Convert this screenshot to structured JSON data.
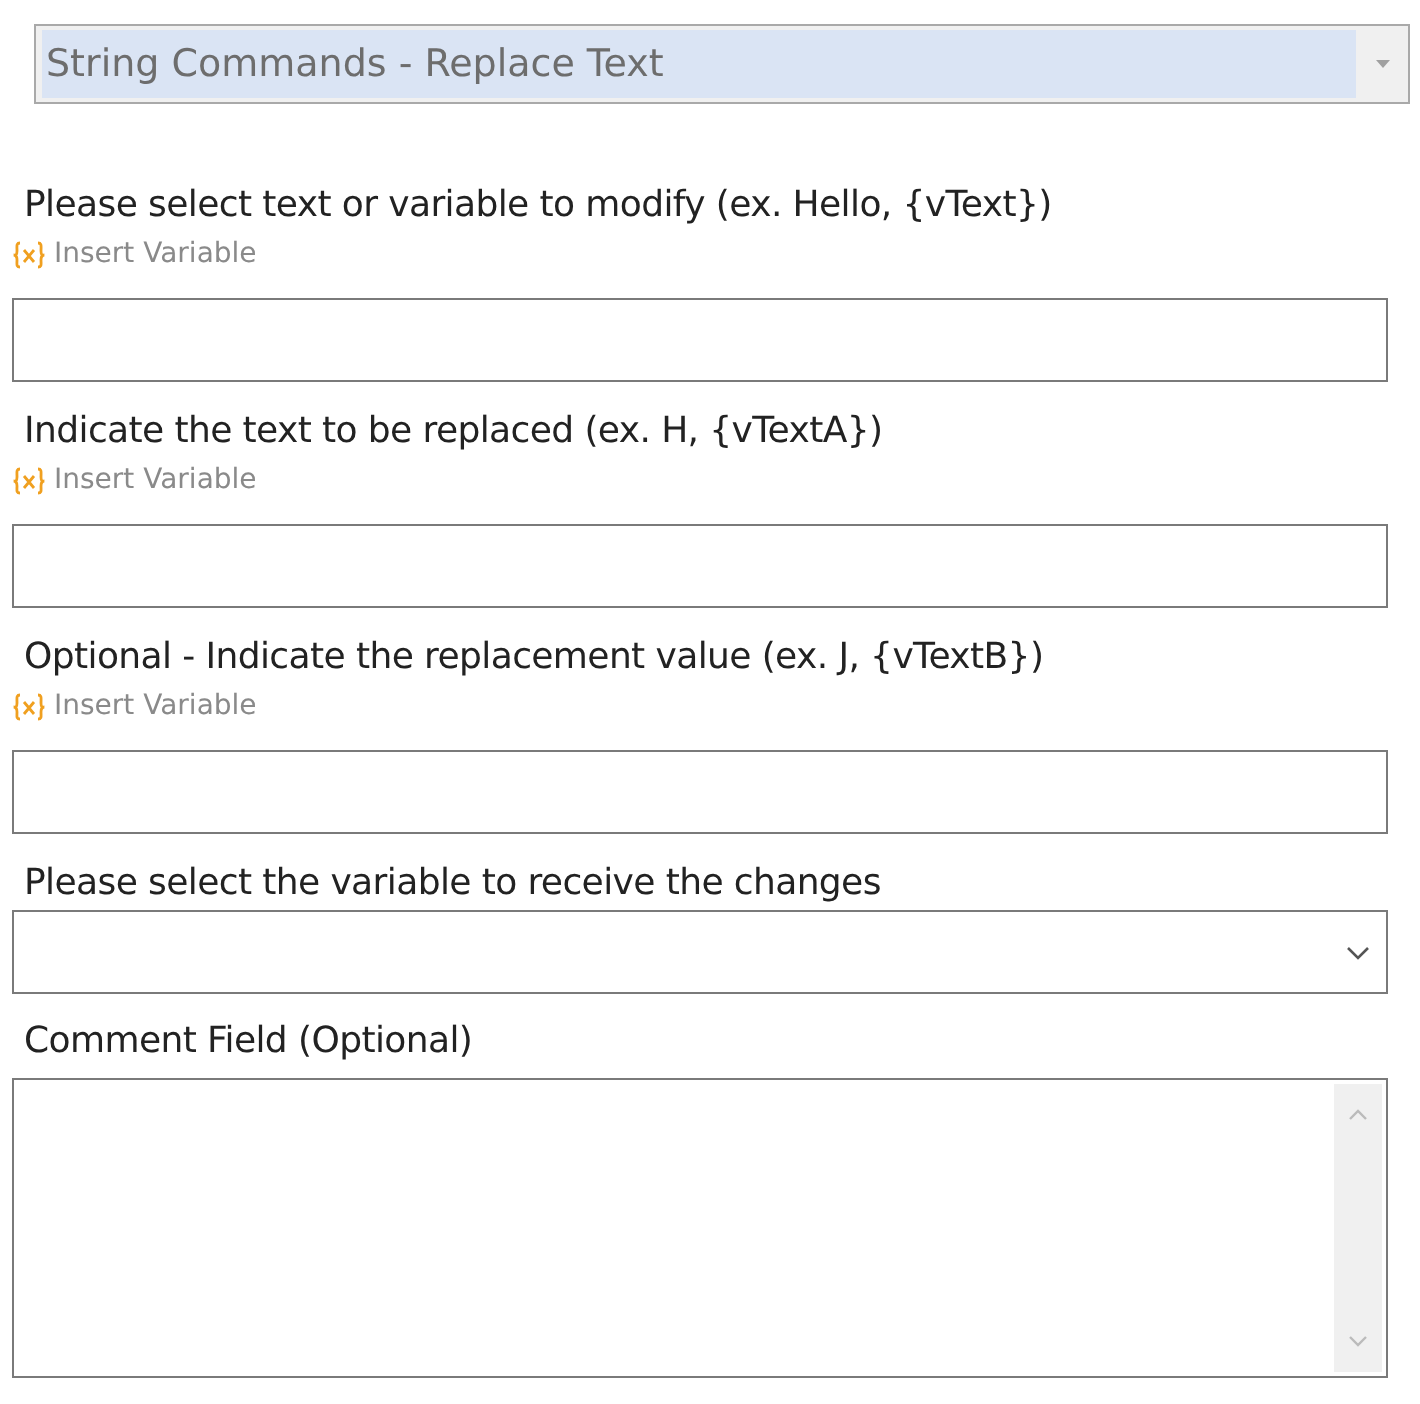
{
  "command_select": {
    "value": "String Commands - Replace Text",
    "selected": true
  },
  "fields": [
    {
      "kind": "text",
      "label": "Please select text or variable to modify (ex. Hello, {vText})",
      "insert_variable": "Insert Variable"
    },
    {
      "kind": "text",
      "label": "Indicate the text to be replaced (ex. H, {vTextA})",
      "insert_variable": "Insert Variable"
    },
    {
      "kind": "text",
      "label": "Optional - Indicate the replacement value (ex. J, {vTextB})",
      "insert_variable": "Insert Variable"
    },
    {
      "kind": "dropdown",
      "label": "Please select the variable to receive the changes"
    },
    {
      "kind": "textarea",
      "label": "Comment Field (Optional)"
    }
  ]
}
